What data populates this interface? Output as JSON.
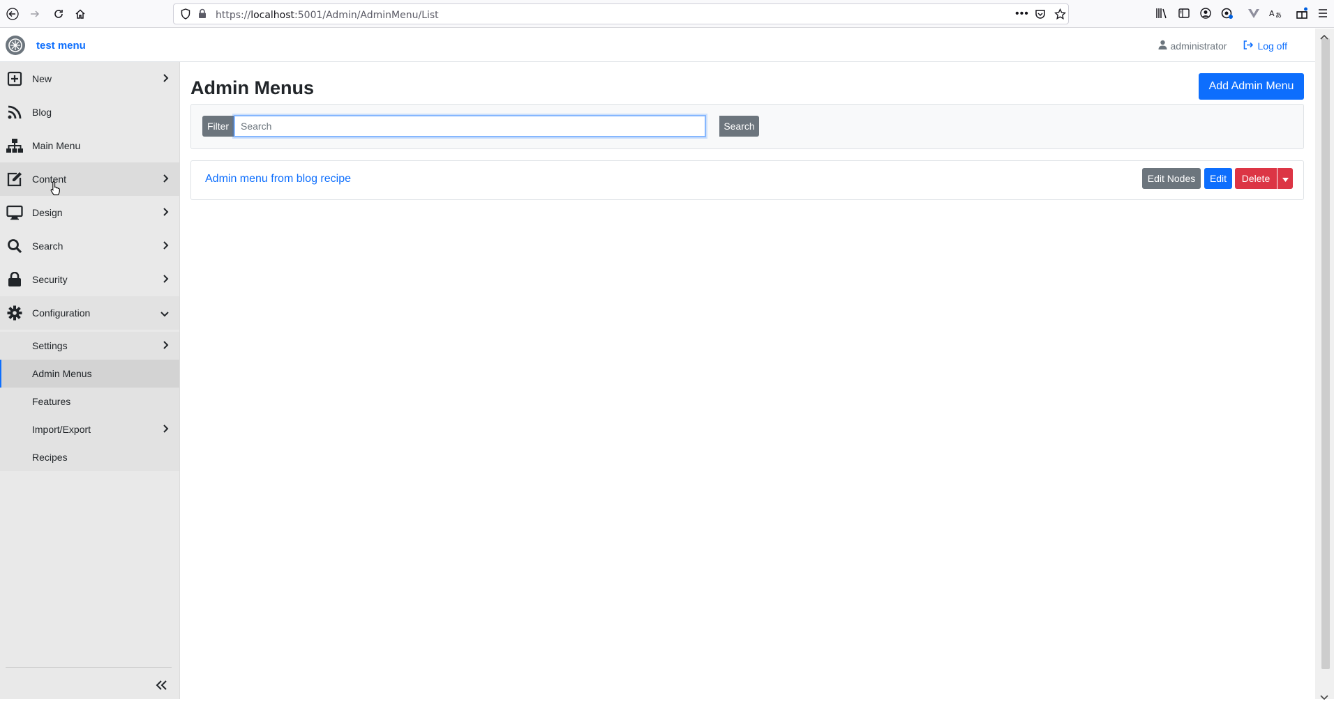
{
  "browser": {
    "url_prefix": "https://",
    "url_host": "localhost",
    "url_rest": ":5001/Admin/AdminMenu/List"
  },
  "header": {
    "brand": "test menu",
    "user": "administrator",
    "logoff": "Log off"
  },
  "sidebar": {
    "items": [
      {
        "label": "New",
        "icon": "plus-square-icon"
      },
      {
        "label": "Blog",
        "icon": "rss-icon"
      },
      {
        "label": "Main Menu",
        "icon": "sitemap-icon"
      },
      {
        "label": "Content",
        "icon": "edit-icon"
      },
      {
        "label": "Design",
        "icon": "desktop-icon"
      },
      {
        "label": "Search",
        "icon": "search-icon"
      },
      {
        "label": "Security",
        "icon": "lock-icon"
      },
      {
        "label": "Configuration",
        "icon": "gear-icon"
      }
    ],
    "sub_items": [
      {
        "label": "Settings"
      },
      {
        "label": "Admin Menus"
      },
      {
        "label": "Features"
      },
      {
        "label": "Import/Export"
      },
      {
        "label": "Recipes"
      }
    ]
  },
  "main": {
    "title": "Admin Menus",
    "add_button": "Add Admin Menu",
    "filter_label": "Filter",
    "search_placeholder": "Search",
    "search_button": "Search",
    "list": [
      {
        "name": "Admin menu from blog recipe",
        "edit_nodes": "Edit Nodes",
        "edit": "Edit",
        "delete": "Delete"
      }
    ]
  },
  "colors": {
    "primary": "#0d6efd",
    "secondary": "#6c757d",
    "danger": "#dc3545",
    "sidebar_bg": "#e9e9e9"
  }
}
